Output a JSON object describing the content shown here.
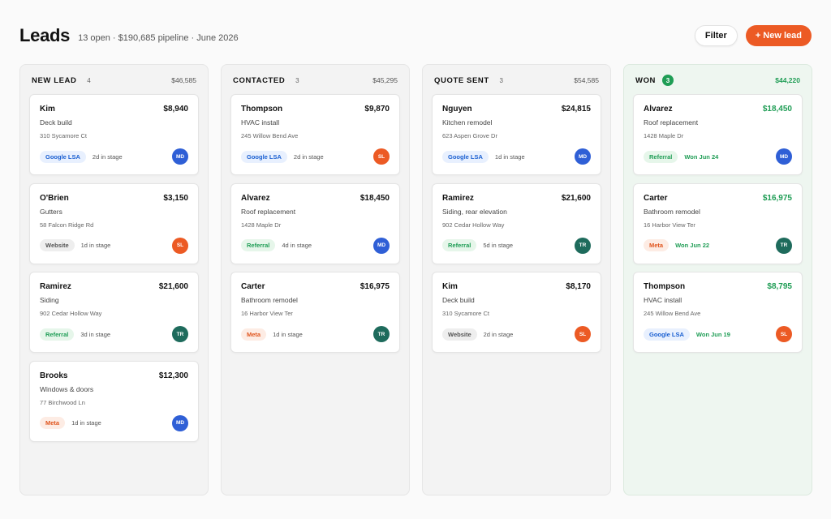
{
  "header": {
    "title": "Leads",
    "subtitle": "13 open · $190,685 pipeline · June 2026",
    "filter_label": "Filter",
    "new_lead_label": "+ New lead"
  },
  "colors": {
    "accent": "#ec5a24",
    "won_green": "#1f9d55",
    "avatar_MD": "#2f5fd6",
    "avatar_SL": "#ec5a24",
    "avatar_TR": "#1e6b5c"
  },
  "columns": [
    {
      "name": "NEW LEAD",
      "count": "4",
      "total": "$46,585",
      "won": false,
      "cards": [
        {
          "name": "Kim",
          "amount": "$8,940",
          "service": "Deck build",
          "address": "310 Sycamore Ct",
          "source": "Google LSA",
          "source_type": "google",
          "stage": "2d in stage",
          "owner": "MD"
        },
        {
          "name": "O'Brien",
          "amount": "$3,150",
          "service": "Gutters",
          "address": "58 Falcon Ridge Rd",
          "source": "Website",
          "source_type": "website",
          "stage": "1d in stage",
          "owner": "SL"
        },
        {
          "name": "Ramirez",
          "amount": "$21,600",
          "service": "Siding",
          "address": "902 Cedar Hollow Way",
          "source": "Referral",
          "source_type": "referral",
          "stage": "3d in stage",
          "owner": "TR"
        },
        {
          "name": "Brooks",
          "amount": "$12,300",
          "service": "Windows & doors",
          "address": "77 Birchwood Ln",
          "source": "Meta",
          "source_type": "meta",
          "stage": "1d in stage",
          "owner": "MD"
        }
      ]
    },
    {
      "name": "CONTACTED",
      "count": "3",
      "total": "$45,295",
      "won": false,
      "cards": [
        {
          "name": "Thompson",
          "amount": "$9,870",
          "service": "HVAC install",
          "address": "245 Willow Bend Ave",
          "source": "Google LSA",
          "source_type": "google",
          "stage": "2d in stage",
          "owner": "SL"
        },
        {
          "name": "Alvarez",
          "amount": "$18,450",
          "service": "Roof replacement",
          "address": "1428 Maple Dr",
          "source": "Referral",
          "source_type": "referral",
          "stage": "4d in stage",
          "owner": "MD"
        },
        {
          "name": "Carter",
          "amount": "$16,975",
          "service": "Bathroom remodel",
          "address": "16 Harbor View Ter",
          "source": "Meta",
          "source_type": "meta",
          "stage": "1d in stage",
          "owner": "TR"
        }
      ]
    },
    {
      "name": "QUOTE SENT",
      "count": "3",
      "total": "$54,585",
      "won": false,
      "cards": [
        {
          "name": "Nguyen",
          "amount": "$24,815",
          "service": "Kitchen remodel",
          "address": "623 Aspen Grove Dr",
          "source": "Google LSA",
          "source_type": "google",
          "stage": "1d in stage",
          "owner": "MD"
        },
        {
          "name": "Ramirez",
          "amount": "$21,600",
          "service": "Siding, rear elevation",
          "address": "902 Cedar Hollow Way",
          "source": "Referral",
          "source_type": "referral",
          "stage": "5d in stage",
          "owner": "TR"
        },
        {
          "name": "Kim",
          "amount": "$8,170",
          "service": "Deck build",
          "address": "310 Sycamore Ct",
          "source": "Website",
          "source_type": "website",
          "stage": "2d in stage",
          "owner": "SL"
        }
      ]
    },
    {
      "name": "WON",
      "count": "3",
      "total": "$44,220",
      "won": true,
      "cards": [
        {
          "name": "Alvarez",
          "amount": "$18,450",
          "service": "Roof replacement",
          "address": "1428 Maple Dr",
          "source": "Referral",
          "source_type": "referral",
          "stage": "Won Jun 24",
          "owner": "MD"
        },
        {
          "name": "Carter",
          "amount": "$16,975",
          "service": "Bathroom remodel",
          "address": "16 Harbor View Ter",
          "source": "Meta",
          "source_type": "meta",
          "stage": "Won Jun 22",
          "owner": "TR"
        },
        {
          "name": "Thompson",
          "amount": "$8,795",
          "service": "HVAC install",
          "address": "245 Willow Bend Ave",
          "source": "Google LSA",
          "source_type": "google",
          "stage": "Won Jun 19",
          "owner": "SL"
        }
      ]
    }
  ]
}
